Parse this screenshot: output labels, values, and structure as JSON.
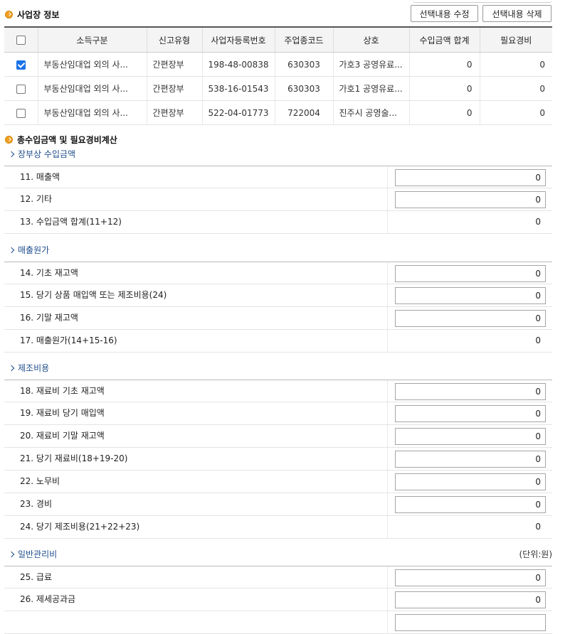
{
  "section1": {
    "title": "사업장 정보",
    "buttons": {
      "edit": "선택내용 수정",
      "delete": "선택내용 삭제"
    },
    "columns": [
      "소득구분",
      "신고유형",
      "사업자등록번호",
      "주업종코드",
      "상호",
      "수입금액 합계",
      "필요경비"
    ],
    "rows": [
      {
        "checked": true,
        "income_type": "부동산임대업 외의 사...",
        "report_type": "간편장부",
        "reg_no": "198-48-00838",
        "industry_code": "630303",
        "company": "가호3 공영유료...",
        "revenue": "0",
        "expense": "0"
      },
      {
        "checked": false,
        "income_type": "부동산임대업 외의 사...",
        "report_type": "간편장부",
        "reg_no": "538-16-01543",
        "industry_code": "630303",
        "company": "가호1 공영유료...",
        "revenue": "0",
        "expense": "0"
      },
      {
        "checked": false,
        "income_type": "부동산임대업 외의 사...",
        "report_type": "간편장부",
        "reg_no": "522-04-01773",
        "industry_code": "722004",
        "company": "진주시 공영술...",
        "revenue": "0",
        "expense": "0"
      }
    ]
  },
  "section2": {
    "title": "총수입금액 및 필요경비계산",
    "unit_label": "(단위:원)",
    "groups": [
      {
        "title": "장부상 수입금액",
        "rows": [
          {
            "label": "11. 매출액",
            "value": "0",
            "editable": true
          },
          {
            "label": "12. 기타",
            "value": "0",
            "editable": true
          },
          {
            "label": "13. 수입금액 합계(11+12)",
            "value": "0",
            "editable": false
          }
        ]
      },
      {
        "title": "매출원가",
        "rows": [
          {
            "label": "14. 기초 재고액",
            "value": "0",
            "editable": true
          },
          {
            "label": "15. 당기 상품 매입액 또는 제조비용(24)",
            "value": "0",
            "editable": true
          },
          {
            "label": "16. 기말 재고액",
            "value": "0",
            "editable": true
          },
          {
            "label": "17. 매출원가(14+15-16)",
            "value": "0",
            "editable": false
          }
        ]
      },
      {
        "title": "제조비용",
        "rows": [
          {
            "label": "18. 재료비 기초 재고액",
            "value": "0",
            "editable": true
          },
          {
            "label": "19. 재료비 당기 매입액",
            "value": "0",
            "editable": true
          },
          {
            "label": "20. 재료비 기말 재고액",
            "value": "0",
            "editable": true
          },
          {
            "label": "21. 당기 재료비(18+19-20)",
            "value": "0",
            "editable": true
          },
          {
            "label": "22. 노무비",
            "value": "0",
            "editable": true
          },
          {
            "label": "23. 경비",
            "value": "0",
            "editable": true
          },
          {
            "label": "24. 당기 제조비용(21+22+23)",
            "value": "0",
            "editable": false
          }
        ]
      },
      {
        "title": "일반관리비",
        "rows": [
          {
            "label": "25. 급료",
            "value": "0",
            "editable": true
          },
          {
            "label": "26. 제세공과금",
            "value": "0",
            "editable": true
          },
          {
            "label": "",
            "value": "",
            "editable": true
          }
        ]
      }
    ]
  }
}
